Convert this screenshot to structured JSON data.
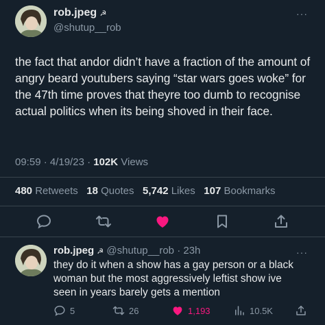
{
  "tweet": {
    "author_name": "rob.jpeg",
    "author_badge": "☭",
    "author_handle": "@shutup__rob",
    "more": "···",
    "text": "the fact that andor didn’t have a fraction of the amount of angry beard youtubers saying “star wars goes woke” for the 47th time proves that theyre too dumb to recognise actual politics when its being shoved in their face.",
    "time": "09:59 · 4/19/23 ·",
    "views_count": "102K",
    "views_label": "Views",
    "retweets_count": "480",
    "retweets_label": "Retweets",
    "quotes_count": "18",
    "quotes_label": "Quotes",
    "likes_count": "5,742",
    "likes_label": "Likes",
    "bookmarks_count": "107",
    "bookmarks_label": "Bookmarks",
    "like_color": "#f91880"
  },
  "reply": {
    "author_name": "rob.jpeg",
    "author_badge": "☭",
    "author_handle": "@shutup__rob",
    "time": "· 23h",
    "more": "···",
    "text": "they do it when a show has a gay person or a black woman but the most aggressively leftist show ive seen in years barely gets a mention",
    "replies": "5",
    "retweets": "26",
    "likes": "1,193",
    "views": "10.5K",
    "like_color": "#f91880"
  }
}
